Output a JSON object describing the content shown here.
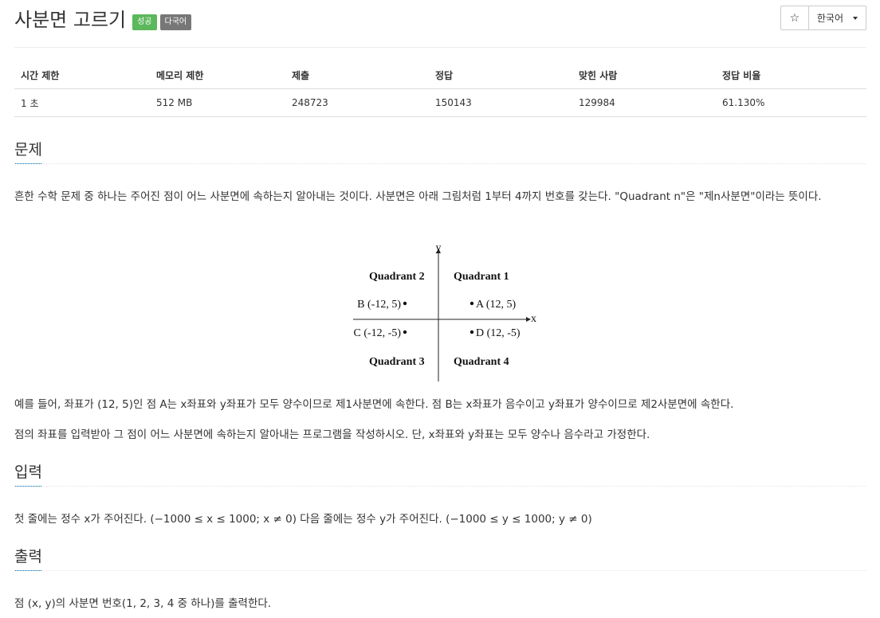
{
  "header": {
    "title": "사분면 고르기",
    "badge_success": "성공",
    "badge_lang": "다국어",
    "star_icon": "☆",
    "lang_button": "한국어"
  },
  "info_table": {
    "headers": [
      "시간 제한",
      "메모리 제한",
      "제출",
      "정답",
      "맞힌 사람",
      "정답 비율"
    ],
    "values": [
      "1 초",
      "512 MB",
      "248723",
      "150143",
      "129984",
      "61.130%"
    ]
  },
  "sections": {
    "problem": {
      "title": "문제",
      "p1": "흔한 수학 문제 중 하나는 주어진 점이 어느 사분면에 속하는지 알아내는 것이다. 사분면은 아래 그림처럼 1부터 4까지 번호를 갖는다. \"Quadrant n\"은 \"제n사분면\"이라는 뜻이다.",
      "p2": "예를 들어, 좌표가 (12, 5)인 점 A는 x좌표와 y좌표가 모두 양수이므로 제1사분면에 속한다. 점 B는 x좌표가 음수이고 y좌표가 양수이므로 제2사분면에 속한다.",
      "p3": "점의 좌표를 입력받아 그 점이 어느 사분면에 속하는지 알아내는 프로그램을 작성하시오. 단, x좌표와 y좌표는 모두 양수나 음수라고 가정한다."
    },
    "input": {
      "title": "입력",
      "p1": "첫 줄에는 정수 x가 주어진다. (−1000 ≤ x ≤ 1000; x ≠ 0) 다음 줄에는 정수 y가 주어진다. (−1000 ≤ y ≤ 1000; y ≠ 0)"
    },
    "output": {
      "title": "출력",
      "p1": "점 (x, y)의 사분면 번호(1, 2, 3, 4 중 하나)를 출력한다."
    }
  },
  "figure": {
    "y_label": "y",
    "x_label": "x",
    "q1": "Quadrant 1",
    "q2": "Quadrant 2",
    "q3": "Quadrant 3",
    "q4": "Quadrant 4",
    "pa": "A (12, 5)",
    "pb": "B (-12, 5)",
    "pc": "C (-12, -5)",
    "pd": "D (12, -5)"
  },
  "colors": {
    "badge_success": "#5cb85c",
    "badge_lang": "#777777",
    "section_underline": "#0076c0"
  }
}
